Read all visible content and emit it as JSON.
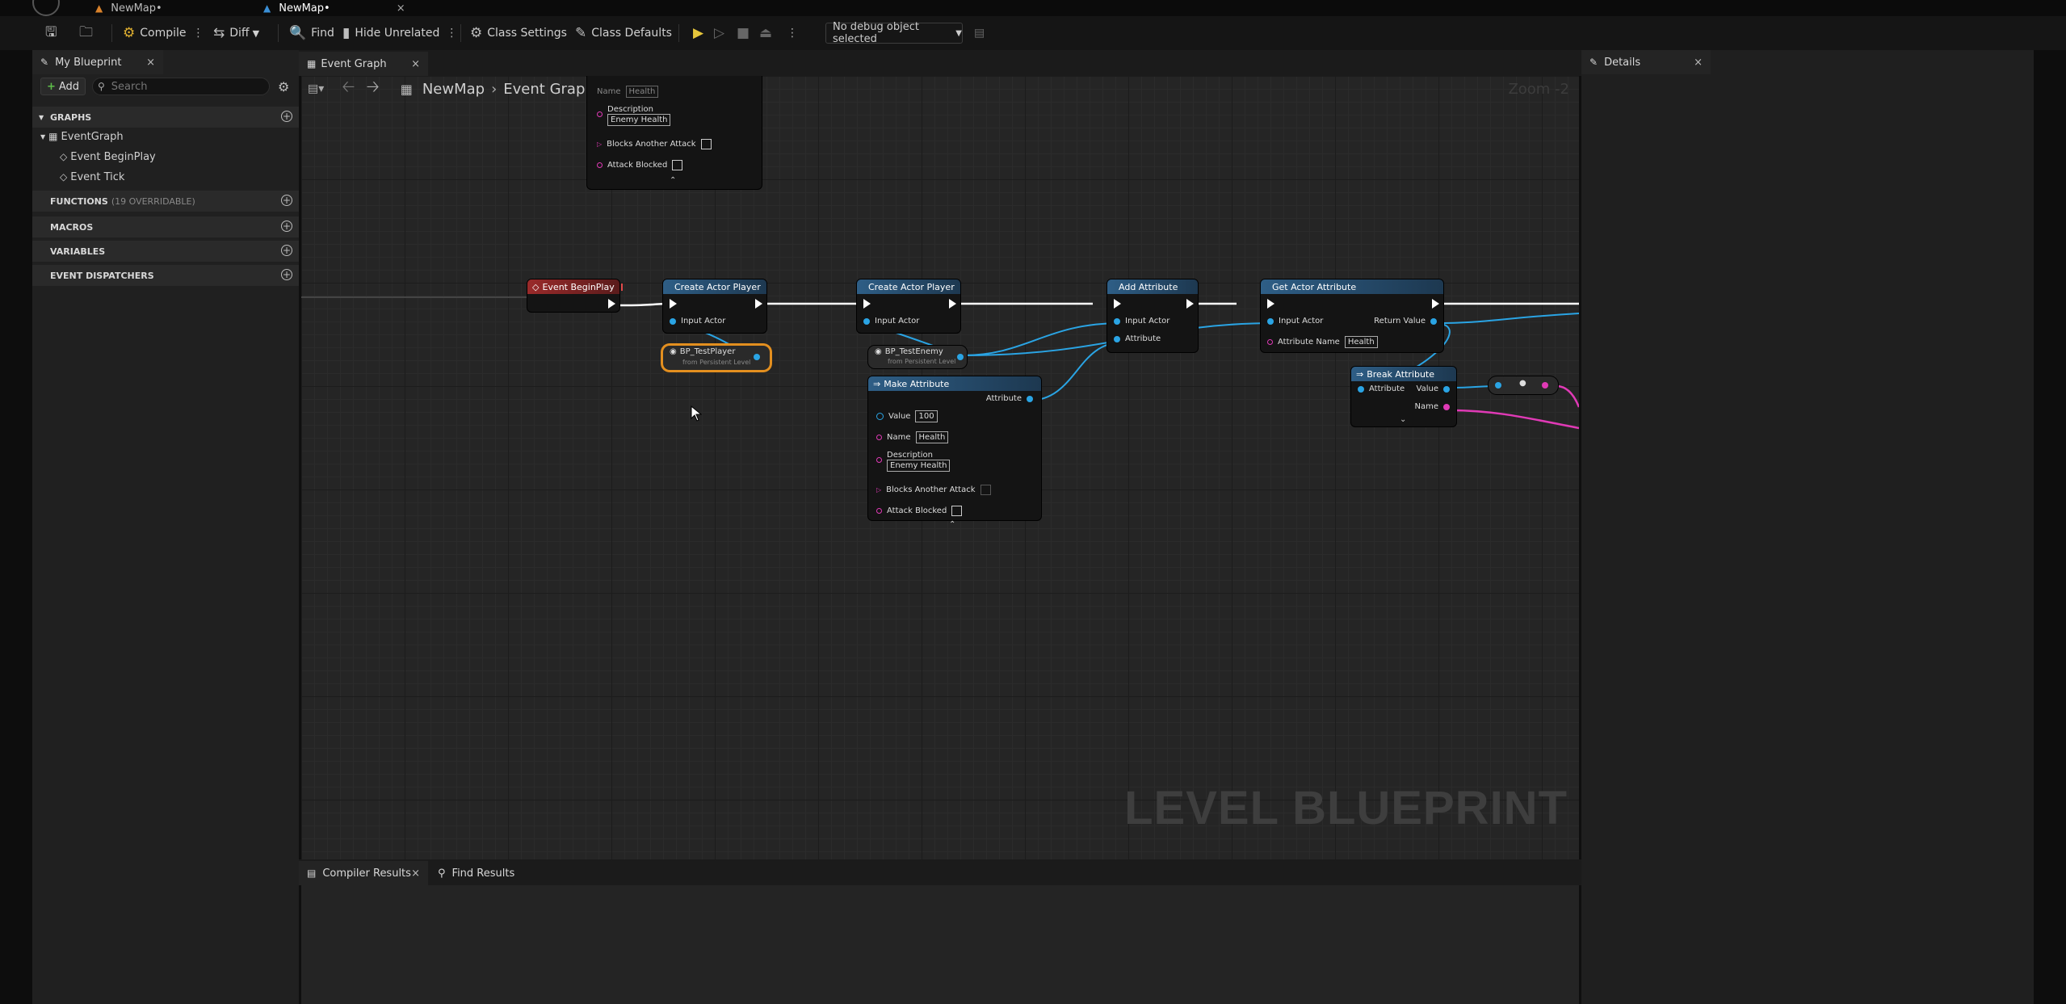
{
  "tabs": [
    {
      "label": "NewMap•"
    },
    {
      "label": "NewMap•",
      "close": "×"
    }
  ],
  "toolbar": {
    "compile": "Compile",
    "diff": "Diff",
    "find": "Find",
    "hide_unrelated": "Hide Unrelated",
    "class_settings": "Class Settings",
    "class_defaults": "Class Defaults",
    "debug_object": "No debug object selected"
  },
  "my_blueprint": {
    "tab_label": "My Blueprint",
    "close": "×",
    "add_label": "Add",
    "search_placeholder": "Search",
    "sections": {
      "graphs": "GRAPHS",
      "functions": "FUNCTIONS",
      "functions_sub": "(19 OVERRIDABLE)",
      "macros": "MACROS",
      "variables": "VARIABLES",
      "event_dispatchers": "EVENT DISPATCHERS"
    },
    "tree": {
      "event_graph": "EventGraph",
      "items": [
        "Event BeginPlay",
        "Event Tick"
      ]
    }
  },
  "graph": {
    "tab_label": "Event Graph",
    "close": "×",
    "breadcrumb_root": "NewMap",
    "breadcrumb_leaf": "Event Graph",
    "zoom": "Zoom -2",
    "watermark": "LEVEL BLUEPRINT",
    "nodes": {
      "top_partial": {
        "name_label": "Name",
        "name_value": "Health",
        "description_label": "Description",
        "description_value": "Enemy Health",
        "blocks_label": "Blocks Another Attack",
        "attack_blocked_label": "Attack Blocked"
      },
      "event_begin_play": {
        "title": "Event BeginPlay"
      },
      "create_actor_player_1": {
        "title": "Create Actor Player",
        "input": "Input Actor"
      },
      "bp_test_player": {
        "title": "BP_TestPlayer",
        "sub": "from Persistent Level"
      },
      "create_actor_player_2": {
        "title": "Create Actor Player",
        "input": "Input Actor"
      },
      "bp_test_enemy": {
        "title": "BP_TestEnemy",
        "sub": "from Persistent Level"
      },
      "make_attribute": {
        "title": "Make Attribute",
        "output": "Attribute",
        "value_label": "Value",
        "value": "100",
        "name_label": "Name",
        "name_value": "Health",
        "description_label": "Description",
        "description_value": "Enemy Health",
        "blocks_label": "Blocks Another Attack",
        "attack_blocked_label": "Attack Blocked"
      },
      "add_attribute": {
        "title": "Add Attribute",
        "input_actor": "Input Actor",
        "attribute": "Attribute"
      },
      "get_actor_attribute": {
        "title": "Get Actor Attribute",
        "input_actor": "Input Actor",
        "return_value": "Return Value",
        "attribute_name_label": "Attribute Name",
        "attribute_name_value": "Health"
      },
      "break_attribute": {
        "title": "Break Attribute",
        "attribute": "Attribute",
        "value": "Value",
        "name": "Name"
      }
    }
  },
  "bottom_tabs": {
    "compiler_results": "Compiler Results",
    "close": "×",
    "find_results": "Find Results"
  },
  "details": {
    "tab_label": "Details",
    "close": "×"
  },
  "colors": {
    "exec": "#ffffff",
    "object_pin": "#2aa4e4",
    "struct_pin": "#e03ab6",
    "event_header": "#8b2323",
    "function_header": "#2e5e86",
    "selection": "#e38f1f"
  }
}
